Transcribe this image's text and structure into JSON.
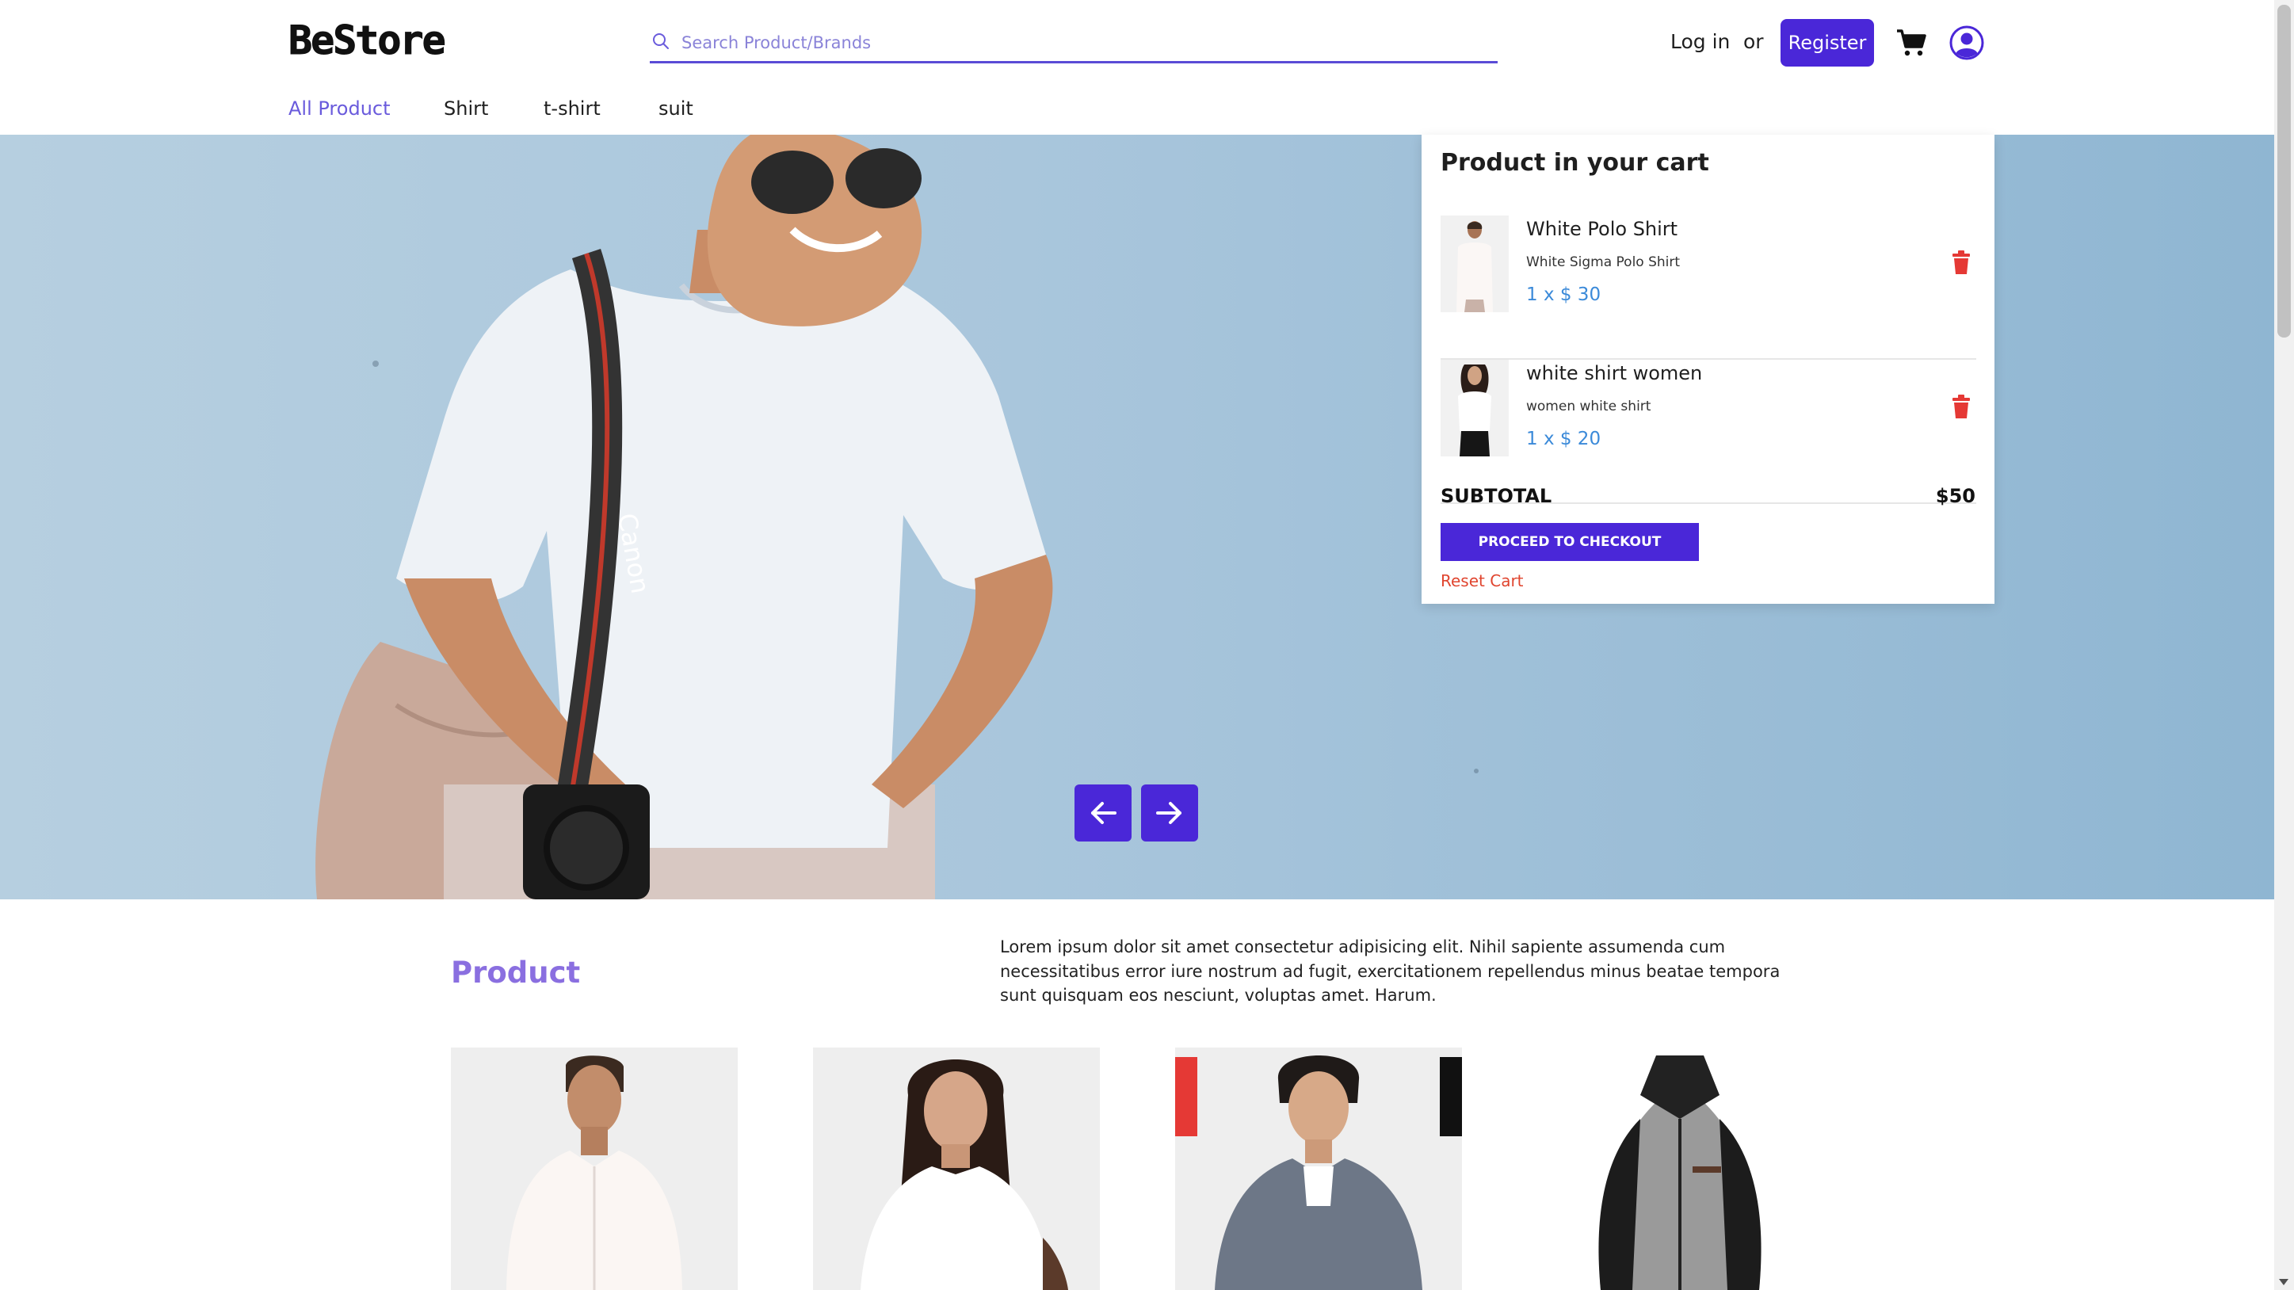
{
  "header": {
    "logo": "BeStore",
    "search_placeholder": "Search Product/Brands",
    "login_label": "Log in",
    "or_label": "or",
    "register_label": "Register"
  },
  "nav": {
    "items": [
      {
        "label": "All Product",
        "active": true
      },
      {
        "label": "Shirt",
        "active": false
      },
      {
        "label": "t-shirt",
        "active": false
      },
      {
        "label": "suit",
        "active": false
      }
    ]
  },
  "cart": {
    "title": "Product in your cart",
    "items": [
      {
        "name": "White Polo Shirt",
        "description": "White Sigma Polo Shirt",
        "price": "1 x $ 30"
      },
      {
        "name": "white shirt women",
        "description": "women white shirt",
        "price": "1 x $ 20"
      }
    ],
    "subtotal_label": "SUBTOTAL",
    "subtotal_value": "$50",
    "checkout_label": "PROCEED TO CHECKOUT",
    "reset_label": "Reset Cart"
  },
  "hero": {
    "prev_icon": "arrow-left-icon",
    "next_icon": "arrow-right-icon"
  },
  "products": {
    "heading": "Product",
    "description": "Lorem ipsum dolor sit amet consectetur adipisicing elit. Nihil sapiente assumenda cum necessitatibus error iure nostrum ad fugit, exercitationem repellendus minus beatae tempora sunt quisquam eos nesciunt, voluptas amet. Harum."
  },
  "colors": {
    "accent": "#4a27d8",
    "price": "#3b8ad9",
    "reset": "#e0452f",
    "heading": "#8a6fe0",
    "delete": "#e53935"
  }
}
